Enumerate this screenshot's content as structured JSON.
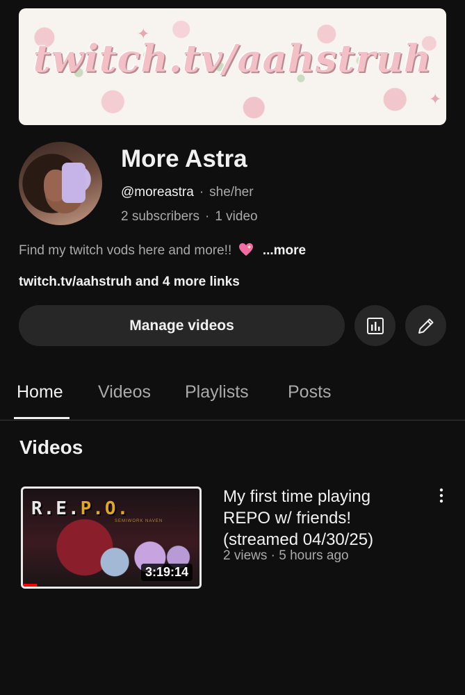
{
  "banner": {
    "text": "twitch.tv/aahstruh"
  },
  "channel": {
    "name": "More Astra",
    "handle": "@moreastra",
    "pronouns": "she/her",
    "subscribers": "2 subscribers",
    "video_count": "1 video",
    "description": "Find my twitch vods here and more!!",
    "more_label": "...more",
    "links_text": "twitch.tv/aahstruh and 4 more links"
  },
  "actions": {
    "manage_label": "Manage videos",
    "analytics_icon": "analytics-icon",
    "edit_icon": "pencil-icon"
  },
  "tabs": [
    {
      "label": "Home",
      "active": true
    },
    {
      "label": "Videos"
    },
    {
      "label": "Playlists"
    },
    {
      "label": "Posts"
    }
  ],
  "section": {
    "title": "Videos"
  },
  "video": {
    "thumb_logo_left": "R.E.",
    "thumb_logo_right": "P.O.",
    "thumb_subtitle": "SEMIWORK NAVEN",
    "duration": "3:19:14",
    "title": "My first time playing REPO w/ friends! (streamed 04/30/25)",
    "meta": "2 views · 5 hours ago",
    "progress_fraction": 0.08
  },
  "colors": {
    "background": "#0f0f0f",
    "button": "#272727",
    "accent_progress": "#ff0000"
  }
}
